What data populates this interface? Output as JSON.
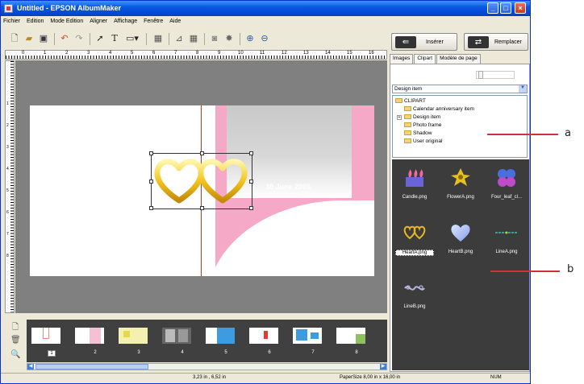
{
  "window": {
    "title": "Untitled - EPSON AlbumMaker"
  },
  "menu": [
    "Fichier",
    "Edition",
    "Mode Edition",
    "Aligner",
    "Affichage",
    "Fenêtre",
    "Aide"
  ],
  "ruler": {
    "h_labels": [
      "0",
      "1",
      "2",
      "3",
      "4",
      "5",
      "6",
      "7",
      "8",
      "9",
      "10",
      "11",
      "12",
      "13",
      "14",
      "15",
      "16"
    ],
    "v_labels": [
      "1",
      "2",
      "3",
      "4",
      "5",
      "6",
      "7",
      "8"
    ]
  },
  "canvas": {
    "date_text": "30 June 2005"
  },
  "thumbnails": {
    "numbers": [
      "1",
      "2",
      "3",
      "4",
      "5",
      "6",
      "7",
      "8"
    ],
    "selected": "1"
  },
  "status": {
    "cursor": "3,23 in , 6,52 in",
    "papersize": "PaperSize  8,00 in x 16,00 in",
    "num": "NUM"
  },
  "panel": {
    "insert_label": "Insérer",
    "replace_label": "Remplacer",
    "tabs": [
      "Images",
      "Clipart",
      "Modèle de page"
    ],
    "active_tab": "Clipart",
    "category": "Design item",
    "tree": {
      "root": "CLIPART",
      "items": [
        "Calendar anniversary item",
        "Design item",
        "Photo frame",
        "Shadow",
        "User original"
      ]
    },
    "cliparts": [
      "Candle.png",
      "FlowerA.png",
      "Four_leaf_cl...",
      "HeartA.png",
      "HeartB.png",
      "LineA.png",
      "LineB.png"
    ],
    "selected_clipart": "HeartA.png"
  },
  "annotations": {
    "a": "a",
    "b": "b"
  },
  "colors": {
    "titlebar": "#0a58e0",
    "canvas": "#808080",
    "photo_pink": "#f6a9c6",
    "clip_bg": "#3c3c3c",
    "annotation": "#d0303a"
  }
}
